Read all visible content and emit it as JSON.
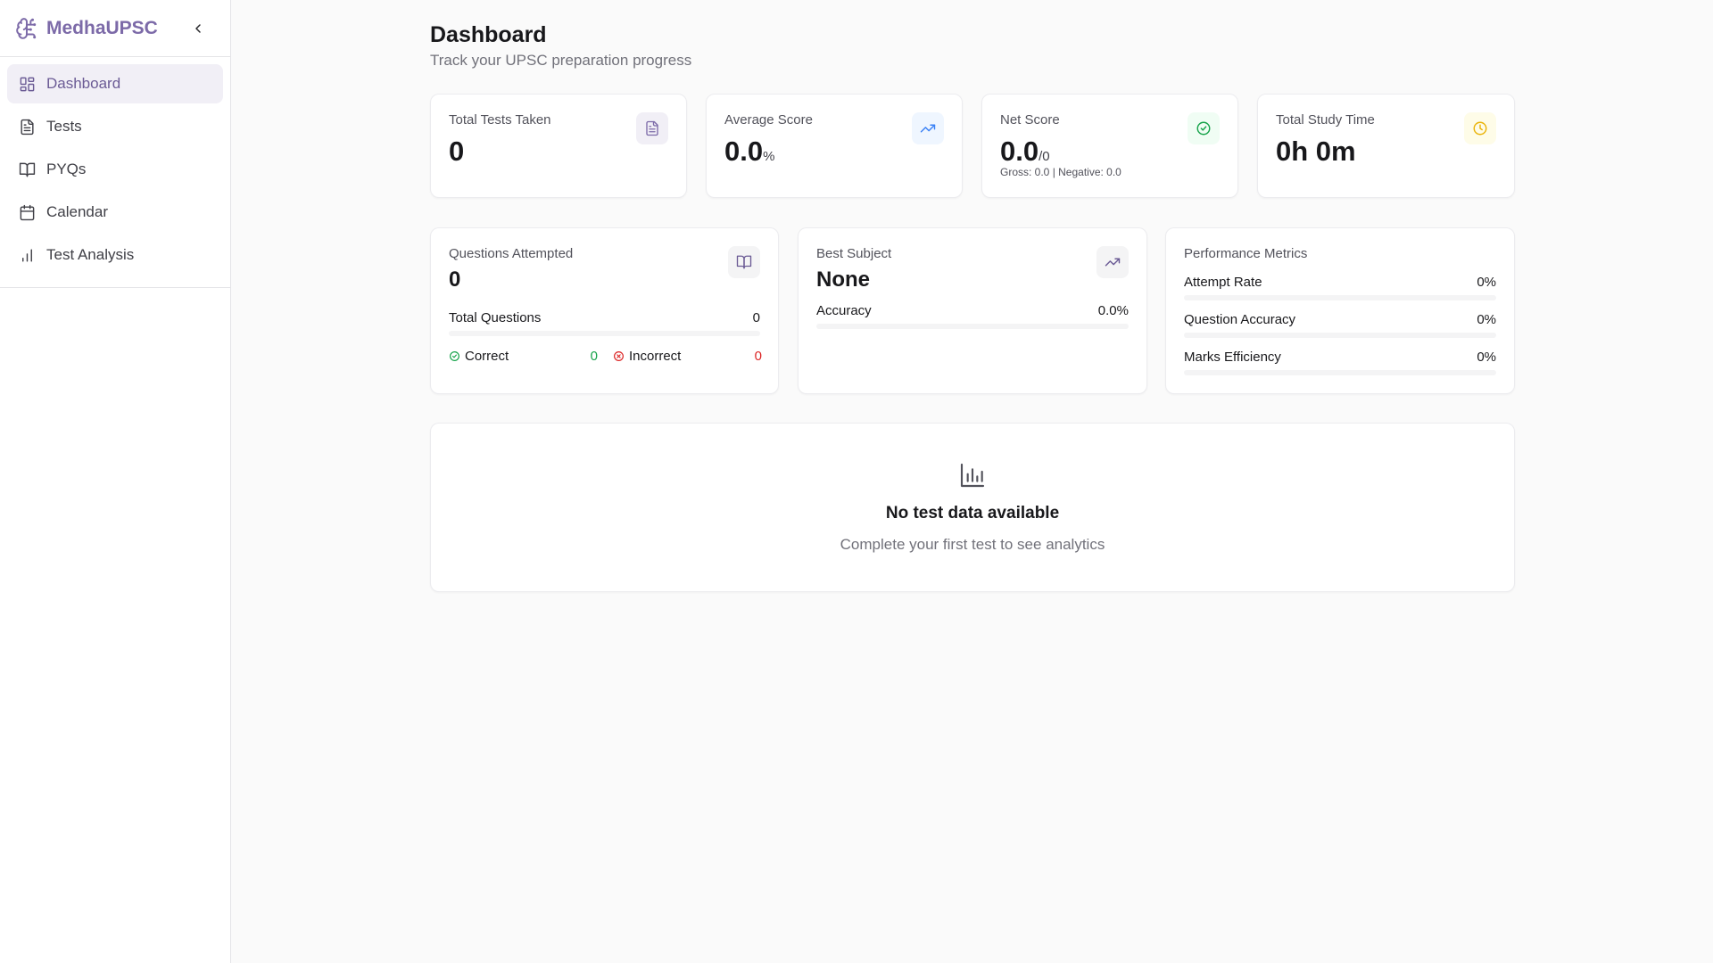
{
  "brand": {
    "name": "MedhaUPSC"
  },
  "sidebar": {
    "items": [
      {
        "label": "Dashboard",
        "icon": "dashboard-icon",
        "active": true
      },
      {
        "label": "Tests",
        "icon": "file-icon"
      },
      {
        "label": "PYQs",
        "icon": "book-icon"
      },
      {
        "label": "Calendar",
        "icon": "calendar-icon"
      },
      {
        "label": "Test Analysis",
        "icon": "bar-chart-icon"
      }
    ]
  },
  "header": {
    "title": "Dashboard",
    "subtitle": "Track your UPSC preparation progress"
  },
  "stats": {
    "total_tests": {
      "label": "Total Tests Taken",
      "value": "0"
    },
    "average_score": {
      "label": "Average Score",
      "value": "0.0",
      "suffix": "%"
    },
    "net_score": {
      "label": "Net Score",
      "value": "0.0",
      "suffix": "/0",
      "detail": "Gross: 0.0 | Negative: 0.0"
    },
    "study_time": {
      "label": "Total Study Time",
      "value": "0h 0m"
    }
  },
  "questions": {
    "label": "Questions Attempted",
    "value": "0",
    "total_label": "Total Questions",
    "total_value": "0",
    "total_fraction": 0,
    "correct_label": "Correct",
    "correct_value": "0",
    "incorrect_label": "Incorrect",
    "incorrect_value": "0"
  },
  "best_subject": {
    "label": "Best Subject",
    "value": "None",
    "accuracy_label": "Accuracy",
    "accuracy_value": "0.0%",
    "accuracy_fraction": 0
  },
  "performance": {
    "title": "Performance Metrics",
    "metrics": [
      {
        "label": "Attempt Rate",
        "value": "0%",
        "fraction": 0
      },
      {
        "label": "Question Accuracy",
        "value": "0%",
        "fraction": 0
      },
      {
        "label": "Marks Efficiency",
        "value": "0%",
        "fraction": 0
      }
    ]
  },
  "empty_state": {
    "title": "No test data available",
    "subtitle": "Complete your first test to see analytics"
  },
  "colors": {
    "brand": "#7c6aa8",
    "active_bg": "#f1eff6",
    "correct": "#16a34a",
    "incorrect": "#dc2626",
    "study_time_accent": "#eab308",
    "average_accent": "#3b82f6"
  }
}
